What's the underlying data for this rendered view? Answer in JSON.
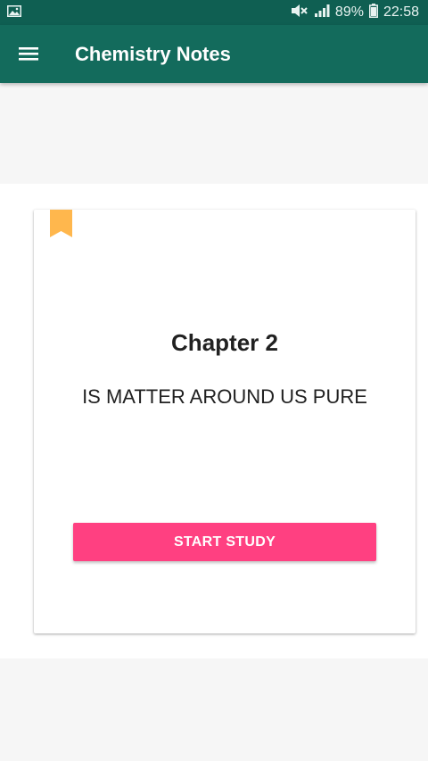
{
  "status_bar": {
    "battery": "89%",
    "time": "22:58",
    "icons": [
      "image-icon",
      "mute-icon",
      "signal-icon",
      "battery-icon"
    ]
  },
  "app_bar": {
    "title": "Chemistry Notes",
    "menu_icon": "menu-icon"
  },
  "card": {
    "bookmark_icon": "bookmark-icon",
    "chapter_title": "Chapter 2",
    "chapter_name": "IS MATTER AROUND US PURE",
    "start_button_label": "START STUDY"
  },
  "colors": {
    "status_bar": "#0f5f52",
    "app_bar": "#136b5c",
    "accent": "#ff4081",
    "bookmark": "#ffb74d",
    "background": "#f6f6f6"
  }
}
